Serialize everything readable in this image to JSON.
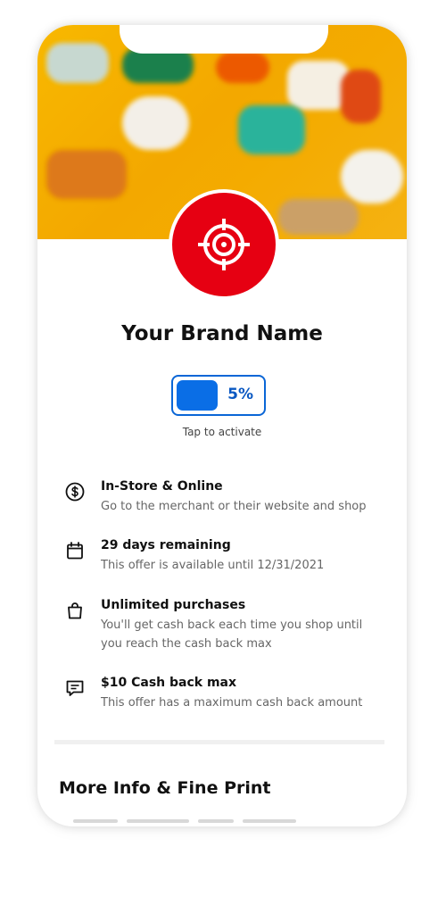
{
  "brand": {
    "name": "Your Brand Name",
    "logo_icon": "target-icon",
    "logo_color": "#e60012"
  },
  "activation": {
    "percent": "5%",
    "tap_label": "Tap to activate",
    "accent": "#0a66d6"
  },
  "features": [
    {
      "icon": "dollar-circle-icon",
      "title": "In-Store & Online",
      "desc": "Go to the merchant or their website and shop"
    },
    {
      "icon": "calendar-icon",
      "title": "29 days remaining",
      "desc": "This offer is available until 12/31/2021"
    },
    {
      "icon": "shopping-bag-icon",
      "title": "Unlimited purchases",
      "desc": "You'll get cash back each time you shop until you reach the cash back max"
    },
    {
      "icon": "message-icon",
      "title": "$10 Cash back max",
      "desc": "This offer has a maximum cash back amount"
    }
  ],
  "more_info": {
    "title": "More Info & Fine Print"
  }
}
